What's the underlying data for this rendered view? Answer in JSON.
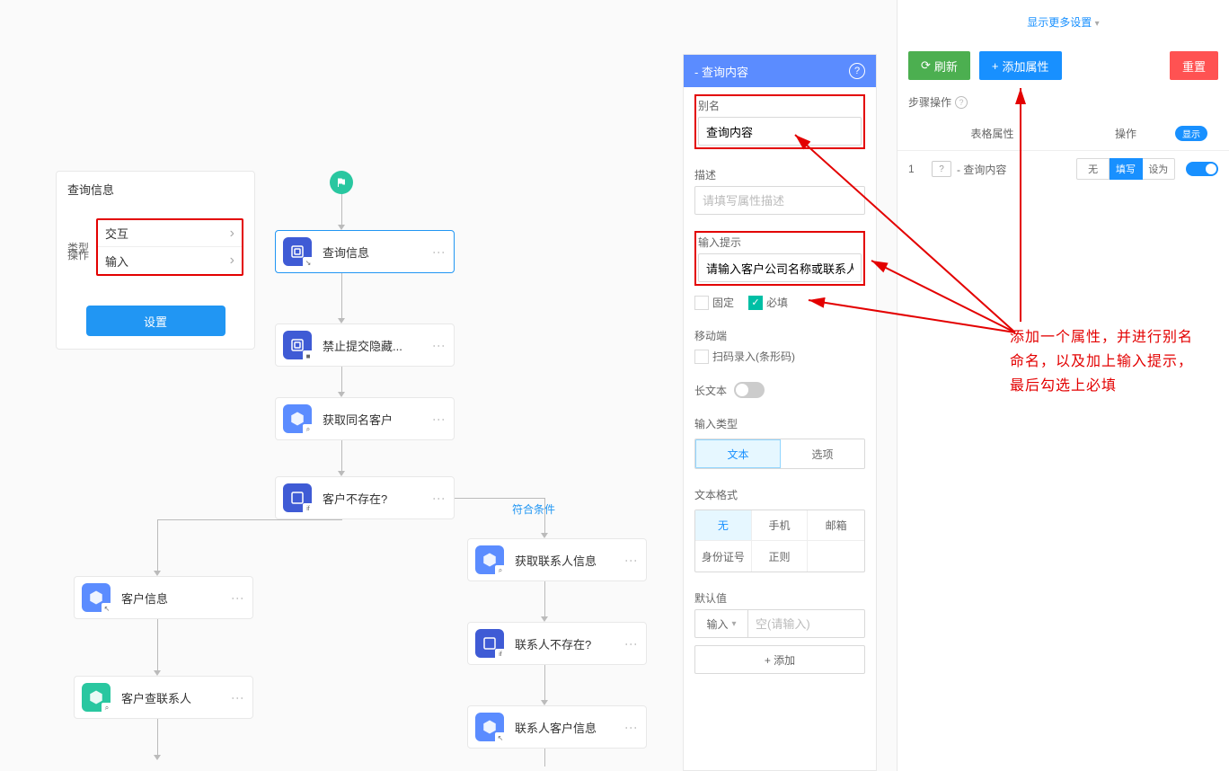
{
  "query_panel": {
    "title": "查询信息",
    "type_label": "类型",
    "type_value": "交互",
    "op_label": "操作",
    "op_value": "输入",
    "setting_btn": "设置"
  },
  "flow": {
    "edge_label": "符合条件",
    "nodes": [
      {
        "label": "查询信息"
      },
      {
        "label": "禁止提交隐藏..."
      },
      {
        "label": "获取同名客户"
      },
      {
        "label": "客户不存在?"
      },
      {
        "label": "客户信息"
      },
      {
        "label": "获取联系人信息"
      },
      {
        "label": "客户查联系人"
      },
      {
        "label": "联系人不存在?"
      },
      {
        "label": "联系人客户信息"
      }
    ]
  },
  "prop": {
    "header": "- 查询内容",
    "alias_label": "别名",
    "alias_value": "查询内容",
    "desc_label": "描述",
    "desc_placeholder": "请填写属性描述",
    "hint_label": "输入提示",
    "hint_value": "请输入客户公司名称或联系人手",
    "fixed": "固定",
    "required": "必填",
    "mobile_label": "移动端",
    "scan_label": "扫码录入(条形码)",
    "longtext_label": "长文本",
    "input_type_label": "输入类型",
    "input_types": [
      "文本",
      "选项"
    ],
    "format_label": "文本格式",
    "formats": [
      "无",
      "手机",
      "邮箱",
      "身份证号",
      "正则"
    ],
    "default_label": "默认值",
    "default_type": "输入",
    "default_placeholder": "空(请输入)",
    "add_btn": "+  添加"
  },
  "right": {
    "more": "显示更多设置",
    "refresh": "刷新",
    "add_prop": "添加属性",
    "reset": "重置",
    "step_label": "步骤操作",
    "th_prop": "表格属性",
    "th_op": "操作",
    "th_badge": "显示",
    "row": {
      "idx": "1",
      "name": "- 查询内容",
      "ops": [
        "无",
        "填写",
        "设为"
      ]
    }
  },
  "annotation": "添加一个属性，并进行别名命名，以及加上输入提示，最后勾选上必填"
}
